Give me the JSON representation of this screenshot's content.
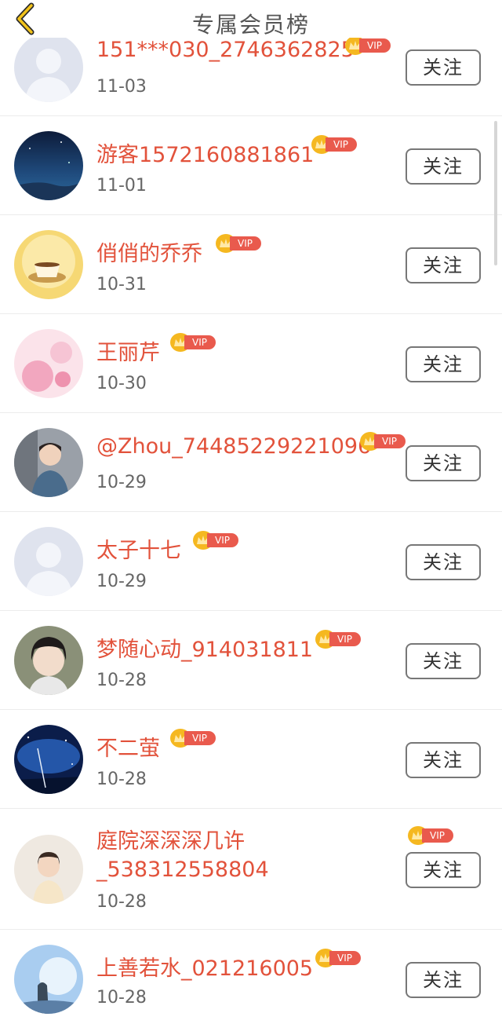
{
  "header": {
    "title": "专属会员榜"
  },
  "vip_label": "VIP",
  "follow_label": "关注",
  "members": [
    {
      "name": "151***030_2746362825",
      "date": "11-03",
      "avatar": "default-avatar"
    },
    {
      "name": "游客1572160881861",
      "date": "11-01",
      "avatar": "night-sky-avatar"
    },
    {
      "name": "俏俏的乔乔",
      "date": "10-31",
      "avatar": "coffee-cup-avatar"
    },
    {
      "name": "王丽芹",
      "date": "10-30",
      "avatar": "pink-flower-avatar"
    },
    {
      "name": "@Zhou_74485229221096",
      "date": "10-29",
      "avatar": "young-man-avatar"
    },
    {
      "name": "太子十七",
      "date": "10-29",
      "avatar": "default-avatar"
    },
    {
      "name": "梦随心动_914031811",
      "date": "10-28",
      "avatar": "girl-portrait-avatar"
    },
    {
      "name": "不二萤",
      "date": "10-28",
      "avatar": "starry-night-avatar"
    },
    {
      "name": "庭院深深深几许_538312558804",
      "date": "10-28",
      "avatar": "child-avatar"
    },
    {
      "name": "上善若水_021216005",
      "date": "10-28",
      "avatar": "sky-silhouette-avatar"
    }
  ],
  "colors": {
    "name": "#e2523b",
    "vip_tag": "#e95a4d",
    "crown": "#f5b820"
  }
}
